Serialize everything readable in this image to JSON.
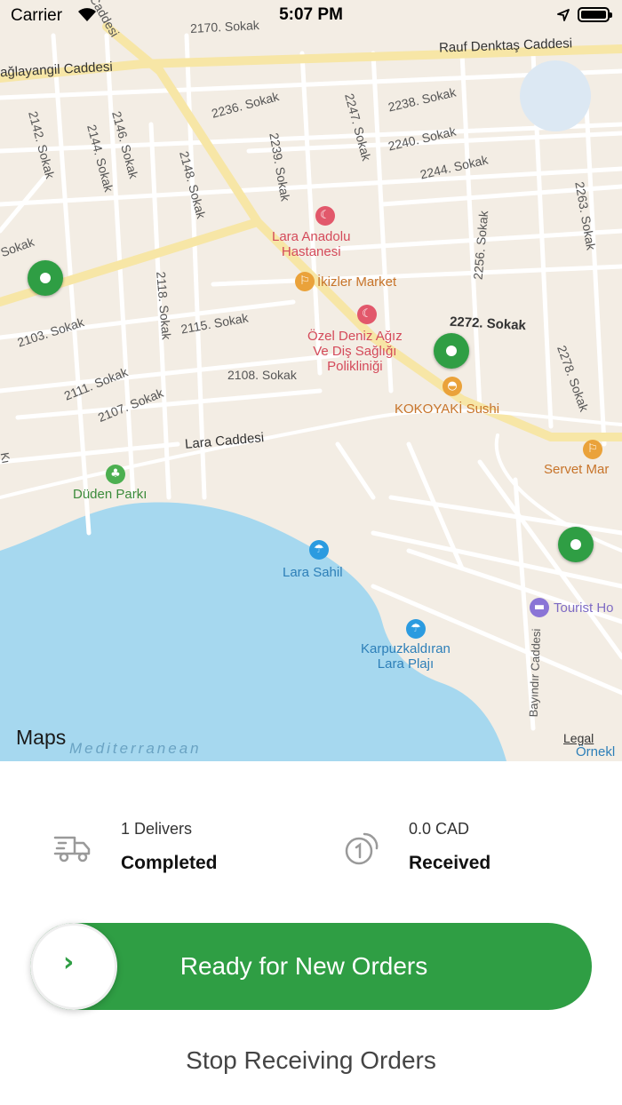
{
  "status_bar": {
    "carrier": "Carrier",
    "time": "5:07 PM"
  },
  "map": {
    "streets": {
      "s1": "2170. Sokak",
      "s2": "Rauf Denktaş Caddesi",
      "s3": "ağlayangil Caddesi",
      "s4": "2236. Sokak",
      "s5": "2238. Sokak",
      "s6": "2240. Sokak",
      "s7": "2244. Sokak",
      "s8": "2142. Sokak",
      "s9": "2144. Sokak",
      "s10": "2146. Sokak",
      "s11": "2148. Sokak",
      "s12": "2239. Sokak",
      "s13": "2247. Sokak",
      "s14": "2263. Sokak",
      "s15": "2256. Sokak",
      "s16": "2272. Sokak",
      "s17": "2278. Sokak",
      "s18": "2103. Sokak",
      "s19": "2115. Sokak",
      "s20": "2118. Sokak",
      "s21": "2111. Sokak",
      "s22": "2108. Sokak",
      "s23": "2107. Sokak",
      "s24": "Lara Caddesi",
      "s25": "Bayındır Caddesi",
      "s26": "Sokak",
      "s27": "Caddesi",
      "s28": "Kı"
    },
    "pois": {
      "hospital": "Lara Anadolu\nHastanesi",
      "market": "İkizler Market",
      "clinic": "Özel Deniz Ağız\nVe Diş Sağlığı\nPolikliniği",
      "sushi": "KOKOYAKİ Sushi",
      "servet": "Servet Mar",
      "park": "Düden Parkı",
      "beach": "Lara Sahil",
      "karpuz": "Karpuzkaldıran\nLara Plajı",
      "tourist": "Tourist Ho",
      "ornek": "Örnekl",
      "sea": "Mediterranean"
    },
    "attribution": "Maps",
    "legal": "Legal"
  },
  "stats": {
    "deliveries": {
      "count": "1 Delivers",
      "label": "Completed"
    },
    "earnings": {
      "amount": "0.0 CAD",
      "label": "Received"
    }
  },
  "actions": {
    "ready_label": "Ready for New Orders",
    "stop_label": "Stop Receiving Orders"
  },
  "colors": {
    "accent": "#2f9e44"
  }
}
